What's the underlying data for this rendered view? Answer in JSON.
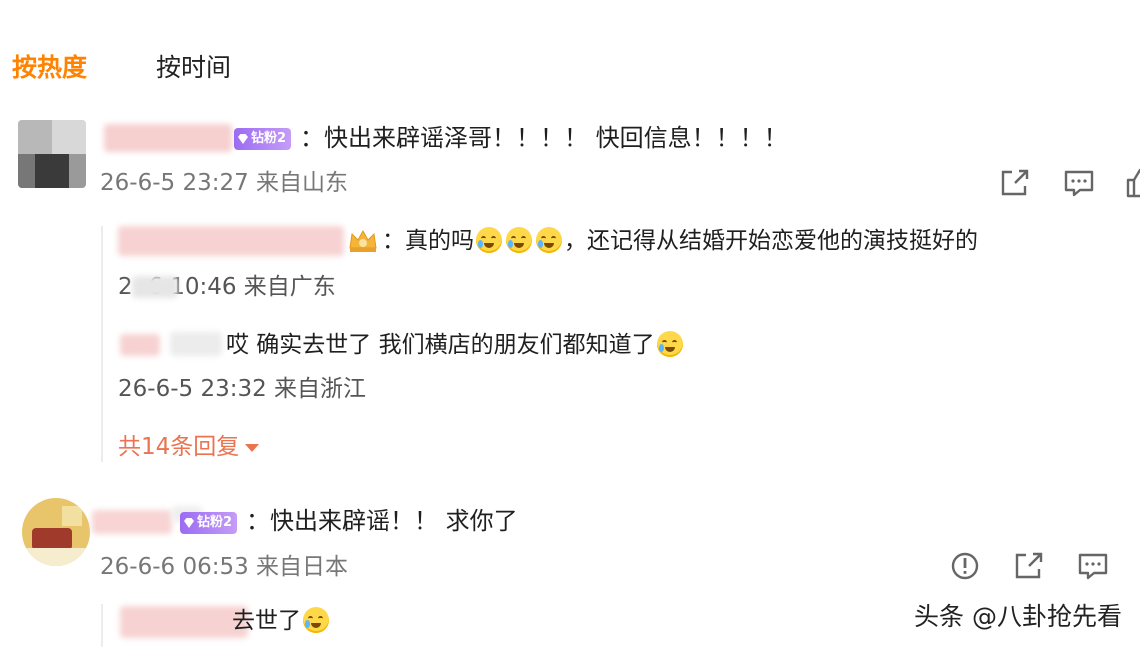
{
  "tabs": {
    "hot": "按热度",
    "time": "按时间"
  },
  "comments": [
    {
      "badge": "钻粉2",
      "text": "：快出来辟谣泽哥！！！！ 快回信息！！！！",
      "meta": "26-6-5 23:27 来自山东",
      "replies": [
        {
          "text_a": "：真的吗",
          "text_b": "，还记得从结婚开始恋爱他的演技挺好的",
          "meta": "2      -6 10:46 来自广东"
        },
        {
          "text": "哎 确实去世了 我们横店的朋友们都知道了",
          "meta": "26-6-5 23:32 来自浙江"
        }
      ],
      "more_replies": "共14条回复"
    },
    {
      "badge": "钻粉2",
      "text": "：快出来辟谣！！ 求你了",
      "meta": "26-6-6 06:53 来自日本",
      "replies": [
        {
          "text": "去世了"
        }
      ]
    }
  ],
  "icons": [
    "share-icon",
    "comment-icon",
    "like-icon",
    "report-icon",
    "share-icon",
    "comment-icon"
  ],
  "watermark": "头条 @八卦抢先看"
}
